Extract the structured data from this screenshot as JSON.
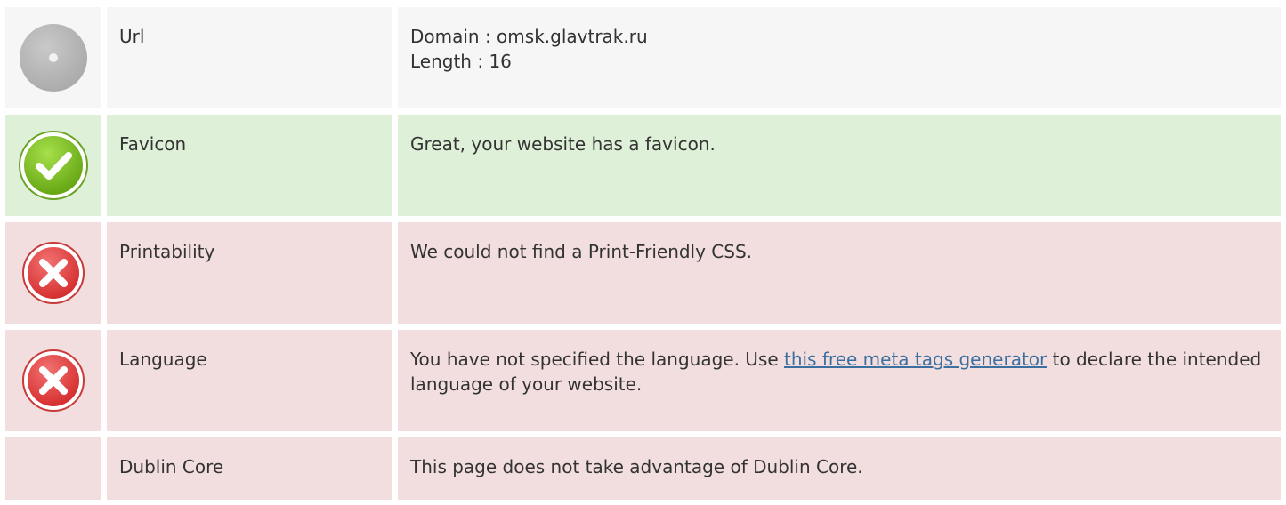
{
  "rows": [
    {
      "status": "neutral",
      "status_icon": "neutral-disc-icon",
      "label": "Url",
      "lines": [
        "Domain : omsk.glavtrak.ru",
        "Length : 16"
      ]
    },
    {
      "status": "pass",
      "status_icon": "check-icon",
      "label": "Favicon",
      "text": "Great, your website has a favicon."
    },
    {
      "status": "fail",
      "status_icon": "error-x-icon",
      "label": "Printability",
      "text": "We could not find a Print-Friendly CSS."
    },
    {
      "status": "fail",
      "status_icon": "error-x-icon",
      "label": "Language",
      "text_before": "You have not specified the language. Use ",
      "link_text": "this free meta tags generator",
      "text_after": " to declare the intended language of your website."
    },
    {
      "status": "fail",
      "status_icon": "",
      "label": "Dublin Core",
      "text": "This page does not take advantage of Dublin Core."
    }
  ],
  "colors": {
    "neutral_bg": "#f6f6f6",
    "pass_bg": "#dff0d8",
    "fail_bg": "#f2dede",
    "link": "#3b6fa0",
    "check_green": "#7cc11f",
    "error_red": "#e84545"
  }
}
